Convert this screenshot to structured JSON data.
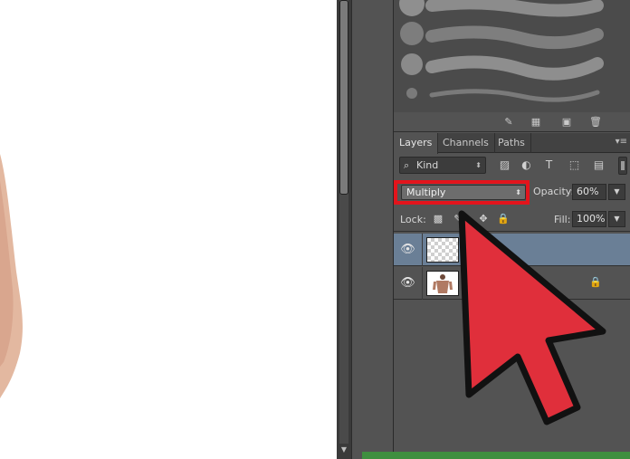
{
  "panels": {
    "tabs": [
      {
        "label": "Layers"
      },
      {
        "label": "Channels"
      },
      {
        "label": "Paths"
      }
    ],
    "filter": {
      "kind_label": "Kind"
    },
    "blend": {
      "mode": "Multiply",
      "opacity_label": "Opacity:",
      "opacity_value": "60%"
    },
    "lock": {
      "label": "Lock:",
      "fill_label": "Fill:",
      "fill_value": "100%"
    },
    "layers": [
      {
        "selected": true,
        "thumbnail": "transparent-checkerboard"
      },
      {
        "selected": false,
        "thumbnail": "person-photo",
        "locked": true
      }
    ]
  },
  "colors": {
    "highlight_red": "#e3141c",
    "arrow_red": "#e02f3b",
    "selected_layer": "#6a7f96",
    "panel_bg": "#535353"
  },
  "icons": {
    "visibility": "eye-icon",
    "lock": "lock-icon",
    "search": "search-icon"
  }
}
